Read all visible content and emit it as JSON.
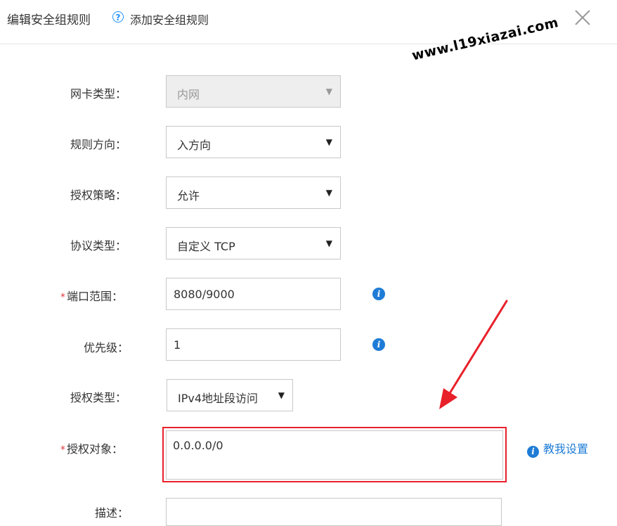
{
  "dialog": {
    "title": "编辑安全组规则",
    "help_icon": "question-circle-icon",
    "help_link": "添加安全组规则",
    "close_icon": "close-icon"
  },
  "watermark": "www.l19xiazai.com",
  "form": {
    "nic_type": {
      "label": "网卡类型：",
      "value": "内网",
      "disabled": true
    },
    "rule_direction": {
      "label": "规则方向：",
      "value": "入方向"
    },
    "auth_policy": {
      "label": "授权策略：",
      "value": "允许"
    },
    "protocol_type": {
      "label": "协议类型：",
      "value": "自定义 TCP"
    },
    "port_range": {
      "label": "端口范围：",
      "required_mark": "*",
      "value": "8080/9000",
      "info_icon": "i"
    },
    "priority": {
      "label": "优先级：",
      "value": "1",
      "info_icon": "i"
    },
    "auth_type": {
      "label": "授权类型：",
      "value": "IPv4地址段访问"
    },
    "auth_object": {
      "label": "授权对象：",
      "required_mark": "*",
      "value": "0.0.0.0/0",
      "help_text": "教我设置",
      "info_icon": "i"
    },
    "description": {
      "label": "描述：",
      "value": ""
    }
  },
  "colors": {
    "accent": "#1e7cd6",
    "highlight": "#e8202a",
    "required": "#e4393c"
  }
}
